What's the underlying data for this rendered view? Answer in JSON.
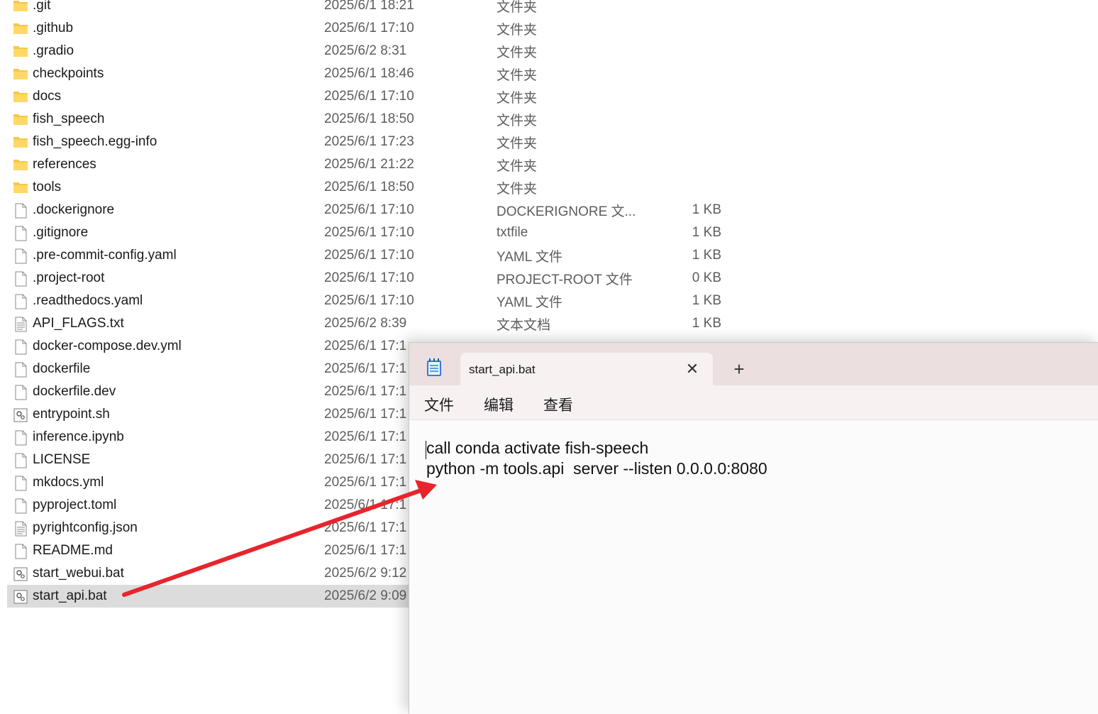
{
  "explorer": {
    "rows": [
      {
        "name": ".git",
        "date": "2025/6/1 18:21",
        "type": "文件夹",
        "size": "",
        "icon": "folder-icon"
      },
      {
        "name": ".github",
        "date": "2025/6/1 17:10",
        "type": "文件夹",
        "size": "",
        "icon": "folder-icon"
      },
      {
        "name": ".gradio",
        "date": "2025/6/2 8:31",
        "type": "文件夹",
        "size": "",
        "icon": "folder-icon"
      },
      {
        "name": "checkpoints",
        "date": "2025/6/1 18:46",
        "type": "文件夹",
        "size": "",
        "icon": "folder-icon"
      },
      {
        "name": "docs",
        "date": "2025/6/1 17:10",
        "type": "文件夹",
        "size": "",
        "icon": "folder-icon"
      },
      {
        "name": "fish_speech",
        "date": "2025/6/1 18:50",
        "type": "文件夹",
        "size": "",
        "icon": "folder-icon"
      },
      {
        "name": "fish_speech.egg-info",
        "date": "2025/6/1 17:23",
        "type": "文件夹",
        "size": "",
        "icon": "folder-icon"
      },
      {
        "name": "references",
        "date": "2025/6/1 21:22",
        "type": "文件夹",
        "size": "",
        "icon": "folder-icon"
      },
      {
        "name": "tools",
        "date": "2025/6/1 18:50",
        "type": "文件夹",
        "size": "",
        "icon": "folder-icon"
      },
      {
        "name": ".dockerignore",
        "date": "2025/6/1 17:10",
        "type": "DOCKERIGNORE 文...",
        "size": "1 KB",
        "icon": "file-icon"
      },
      {
        "name": ".gitignore",
        "date": "2025/6/1 17:10",
        "type": "txtfile",
        "size": "1 KB",
        "icon": "file-icon"
      },
      {
        "name": ".pre-commit-config.yaml",
        "date": "2025/6/1 17:10",
        "type": "YAML 文件",
        "size": "1 KB",
        "icon": "file-icon"
      },
      {
        "name": ".project-root",
        "date": "2025/6/1 17:10",
        "type": "PROJECT-ROOT 文件",
        "size": "0 KB",
        "icon": "file-icon"
      },
      {
        "name": ".readthedocs.yaml",
        "date": "2025/6/1 17:10",
        "type": "YAML 文件",
        "size": "1 KB",
        "icon": "file-icon"
      },
      {
        "name": "API_FLAGS.txt",
        "date": "2025/6/2 8:39",
        "type": "文本文档",
        "size": "1 KB",
        "icon": "text-file-icon"
      },
      {
        "name": "docker-compose.dev.yml",
        "date": "2025/6/1 17:1",
        "type": "",
        "size": "",
        "icon": "file-icon"
      },
      {
        "name": "dockerfile",
        "date": "2025/6/1 17:1",
        "type": "",
        "size": "",
        "icon": "file-icon"
      },
      {
        "name": "dockerfile.dev",
        "date": "2025/6/1 17:1",
        "type": "",
        "size": "",
        "icon": "file-icon"
      },
      {
        "name": "entrypoint.sh",
        "date": "2025/6/1 17:1",
        "type": "",
        "size": "",
        "icon": "script-file-icon"
      },
      {
        "name": "inference.ipynb",
        "date": "2025/6/1 17:1",
        "type": "",
        "size": "",
        "icon": "file-icon"
      },
      {
        "name": "LICENSE",
        "date": "2025/6/1 17:1",
        "type": "",
        "size": "",
        "icon": "file-icon"
      },
      {
        "name": "mkdocs.yml",
        "date": "2025/6/1 17:1",
        "type": "",
        "size": "",
        "icon": "file-icon"
      },
      {
        "name": "pyproject.toml",
        "date": "2025/6/1 17:1",
        "type": "",
        "size": "",
        "icon": "file-icon"
      },
      {
        "name": "pyrightconfig.json",
        "date": "2025/6/1 17:1",
        "type": "",
        "size": "",
        "icon": "text-file-icon"
      },
      {
        "name": "README.md",
        "date": "2025/6/1 17:1",
        "type": "",
        "size": "",
        "icon": "file-icon"
      },
      {
        "name": "start_webui.bat",
        "date": "2025/6/2 9:12",
        "type": "",
        "size": "",
        "icon": "script-file-icon"
      },
      {
        "name": "start_api.bat",
        "date": "2025/6/2 9:09",
        "type": "",
        "size": "",
        "icon": "script-file-icon",
        "selected": true
      }
    ]
  },
  "notepad": {
    "app_icon": "notepad-icon",
    "tab_title": "start_api.bat",
    "close_glyph": "✕",
    "new_tab_glyph": "+",
    "menu": {
      "file": "文件",
      "edit": "编辑",
      "view": "查看"
    },
    "lines": [
      "call conda activate fish-speech",
      "python -m tools.api  server --listen 0.0.0.0:8080"
    ]
  },
  "annotation": {
    "arrow_color": "#e8242c"
  }
}
